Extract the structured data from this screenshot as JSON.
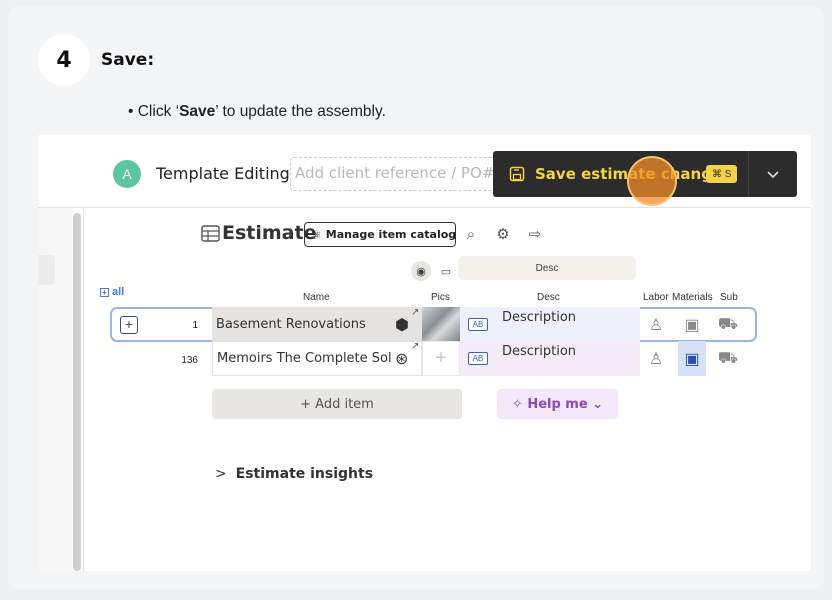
{
  "step": {
    "number": "4",
    "title": "Save:"
  },
  "instruction": {
    "prefix": "• Click ‘",
    "bold": "Save",
    "suffix": "’ to update the assembly."
  },
  "topbar": {
    "avatar_letter": "A",
    "template_label": "Template Editing",
    "client_ref_placeholder": "Add client reference / PO#",
    "save_label": "Save estimate changes",
    "shortcut": "⌘ S"
  },
  "estimate": {
    "title": "Estimate",
    "catalog_button": "Manage item catalog",
    "column_desc_pill": "Desc",
    "all_label": "all",
    "columns": {
      "name": "Name",
      "pics": "Pics",
      "desc": "Desc",
      "labor": "Labor",
      "materials": "Materials",
      "sub": "Sub"
    },
    "rows": [
      {
        "num": "1",
        "name": "Basement Renovations",
        "desc": "Description",
        "tag": "AB"
      },
      {
        "num": "136",
        "name": "Memoirs The Complete Sol",
        "desc": "Description",
        "tag": "AB"
      }
    ],
    "add_item": "+ Add item",
    "help_me": "✧ Help me ⌄",
    "insights": "Estimate insights",
    "insights_chevron": ">"
  },
  "colors": {
    "save_bg": "#2c2c2c",
    "save_text": "#f6d247",
    "avatar": "#5bc6a0",
    "highlight": "#f08c28"
  }
}
